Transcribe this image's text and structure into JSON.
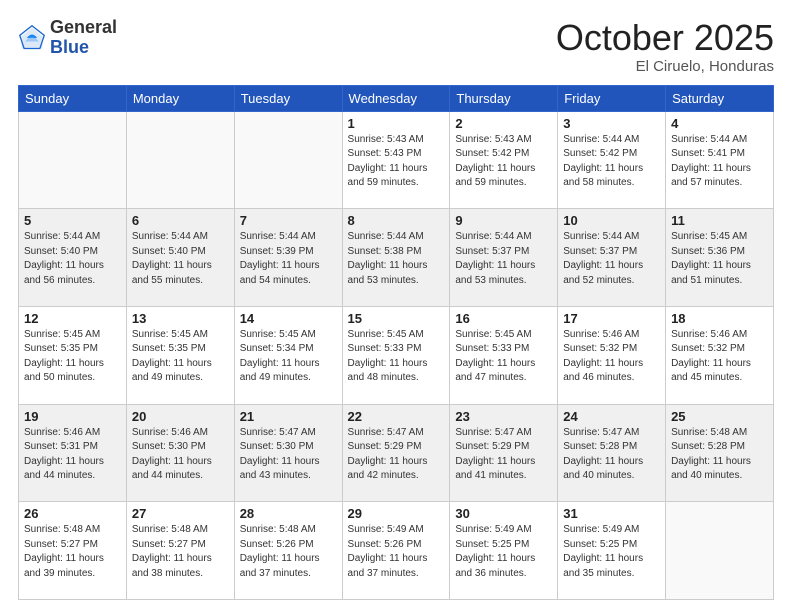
{
  "header": {
    "logo_general": "General",
    "logo_blue": "Blue",
    "month_title": "October 2025",
    "location": "El Ciruelo, Honduras"
  },
  "calendar": {
    "days_of_week": [
      "Sunday",
      "Monday",
      "Tuesday",
      "Wednesday",
      "Thursday",
      "Friday",
      "Saturday"
    ],
    "weeks": [
      [
        {
          "day": "",
          "info": ""
        },
        {
          "day": "",
          "info": ""
        },
        {
          "day": "",
          "info": ""
        },
        {
          "day": "1",
          "info": "Sunrise: 5:43 AM\nSunset: 5:43 PM\nDaylight: 11 hours\nand 59 minutes."
        },
        {
          "day": "2",
          "info": "Sunrise: 5:43 AM\nSunset: 5:42 PM\nDaylight: 11 hours\nand 59 minutes."
        },
        {
          "day": "3",
          "info": "Sunrise: 5:44 AM\nSunset: 5:42 PM\nDaylight: 11 hours\nand 58 minutes."
        },
        {
          "day": "4",
          "info": "Sunrise: 5:44 AM\nSunset: 5:41 PM\nDaylight: 11 hours\nand 57 minutes."
        }
      ],
      [
        {
          "day": "5",
          "info": "Sunrise: 5:44 AM\nSunset: 5:40 PM\nDaylight: 11 hours\nand 56 minutes."
        },
        {
          "day": "6",
          "info": "Sunrise: 5:44 AM\nSunset: 5:40 PM\nDaylight: 11 hours\nand 55 minutes."
        },
        {
          "day": "7",
          "info": "Sunrise: 5:44 AM\nSunset: 5:39 PM\nDaylight: 11 hours\nand 54 minutes."
        },
        {
          "day": "8",
          "info": "Sunrise: 5:44 AM\nSunset: 5:38 PM\nDaylight: 11 hours\nand 53 minutes."
        },
        {
          "day": "9",
          "info": "Sunrise: 5:44 AM\nSunset: 5:37 PM\nDaylight: 11 hours\nand 53 minutes."
        },
        {
          "day": "10",
          "info": "Sunrise: 5:44 AM\nSunset: 5:37 PM\nDaylight: 11 hours\nand 52 minutes."
        },
        {
          "day": "11",
          "info": "Sunrise: 5:45 AM\nSunset: 5:36 PM\nDaylight: 11 hours\nand 51 minutes."
        }
      ],
      [
        {
          "day": "12",
          "info": "Sunrise: 5:45 AM\nSunset: 5:35 PM\nDaylight: 11 hours\nand 50 minutes."
        },
        {
          "day": "13",
          "info": "Sunrise: 5:45 AM\nSunset: 5:35 PM\nDaylight: 11 hours\nand 49 minutes."
        },
        {
          "day": "14",
          "info": "Sunrise: 5:45 AM\nSunset: 5:34 PM\nDaylight: 11 hours\nand 49 minutes."
        },
        {
          "day": "15",
          "info": "Sunrise: 5:45 AM\nSunset: 5:33 PM\nDaylight: 11 hours\nand 48 minutes."
        },
        {
          "day": "16",
          "info": "Sunrise: 5:45 AM\nSunset: 5:33 PM\nDaylight: 11 hours\nand 47 minutes."
        },
        {
          "day": "17",
          "info": "Sunrise: 5:46 AM\nSunset: 5:32 PM\nDaylight: 11 hours\nand 46 minutes."
        },
        {
          "day": "18",
          "info": "Sunrise: 5:46 AM\nSunset: 5:32 PM\nDaylight: 11 hours\nand 45 minutes."
        }
      ],
      [
        {
          "day": "19",
          "info": "Sunrise: 5:46 AM\nSunset: 5:31 PM\nDaylight: 11 hours\nand 44 minutes."
        },
        {
          "day": "20",
          "info": "Sunrise: 5:46 AM\nSunset: 5:30 PM\nDaylight: 11 hours\nand 44 minutes."
        },
        {
          "day": "21",
          "info": "Sunrise: 5:47 AM\nSunset: 5:30 PM\nDaylight: 11 hours\nand 43 minutes."
        },
        {
          "day": "22",
          "info": "Sunrise: 5:47 AM\nSunset: 5:29 PM\nDaylight: 11 hours\nand 42 minutes."
        },
        {
          "day": "23",
          "info": "Sunrise: 5:47 AM\nSunset: 5:29 PM\nDaylight: 11 hours\nand 41 minutes."
        },
        {
          "day": "24",
          "info": "Sunrise: 5:47 AM\nSunset: 5:28 PM\nDaylight: 11 hours\nand 40 minutes."
        },
        {
          "day": "25",
          "info": "Sunrise: 5:48 AM\nSunset: 5:28 PM\nDaylight: 11 hours\nand 40 minutes."
        }
      ],
      [
        {
          "day": "26",
          "info": "Sunrise: 5:48 AM\nSunset: 5:27 PM\nDaylight: 11 hours\nand 39 minutes."
        },
        {
          "day": "27",
          "info": "Sunrise: 5:48 AM\nSunset: 5:27 PM\nDaylight: 11 hours\nand 38 minutes."
        },
        {
          "day": "28",
          "info": "Sunrise: 5:48 AM\nSunset: 5:26 PM\nDaylight: 11 hours\nand 37 minutes."
        },
        {
          "day": "29",
          "info": "Sunrise: 5:49 AM\nSunset: 5:26 PM\nDaylight: 11 hours\nand 37 minutes."
        },
        {
          "day": "30",
          "info": "Sunrise: 5:49 AM\nSunset: 5:25 PM\nDaylight: 11 hours\nand 36 minutes."
        },
        {
          "day": "31",
          "info": "Sunrise: 5:49 AM\nSunset: 5:25 PM\nDaylight: 11 hours\nand 35 minutes."
        },
        {
          "day": "",
          "info": ""
        }
      ]
    ]
  }
}
